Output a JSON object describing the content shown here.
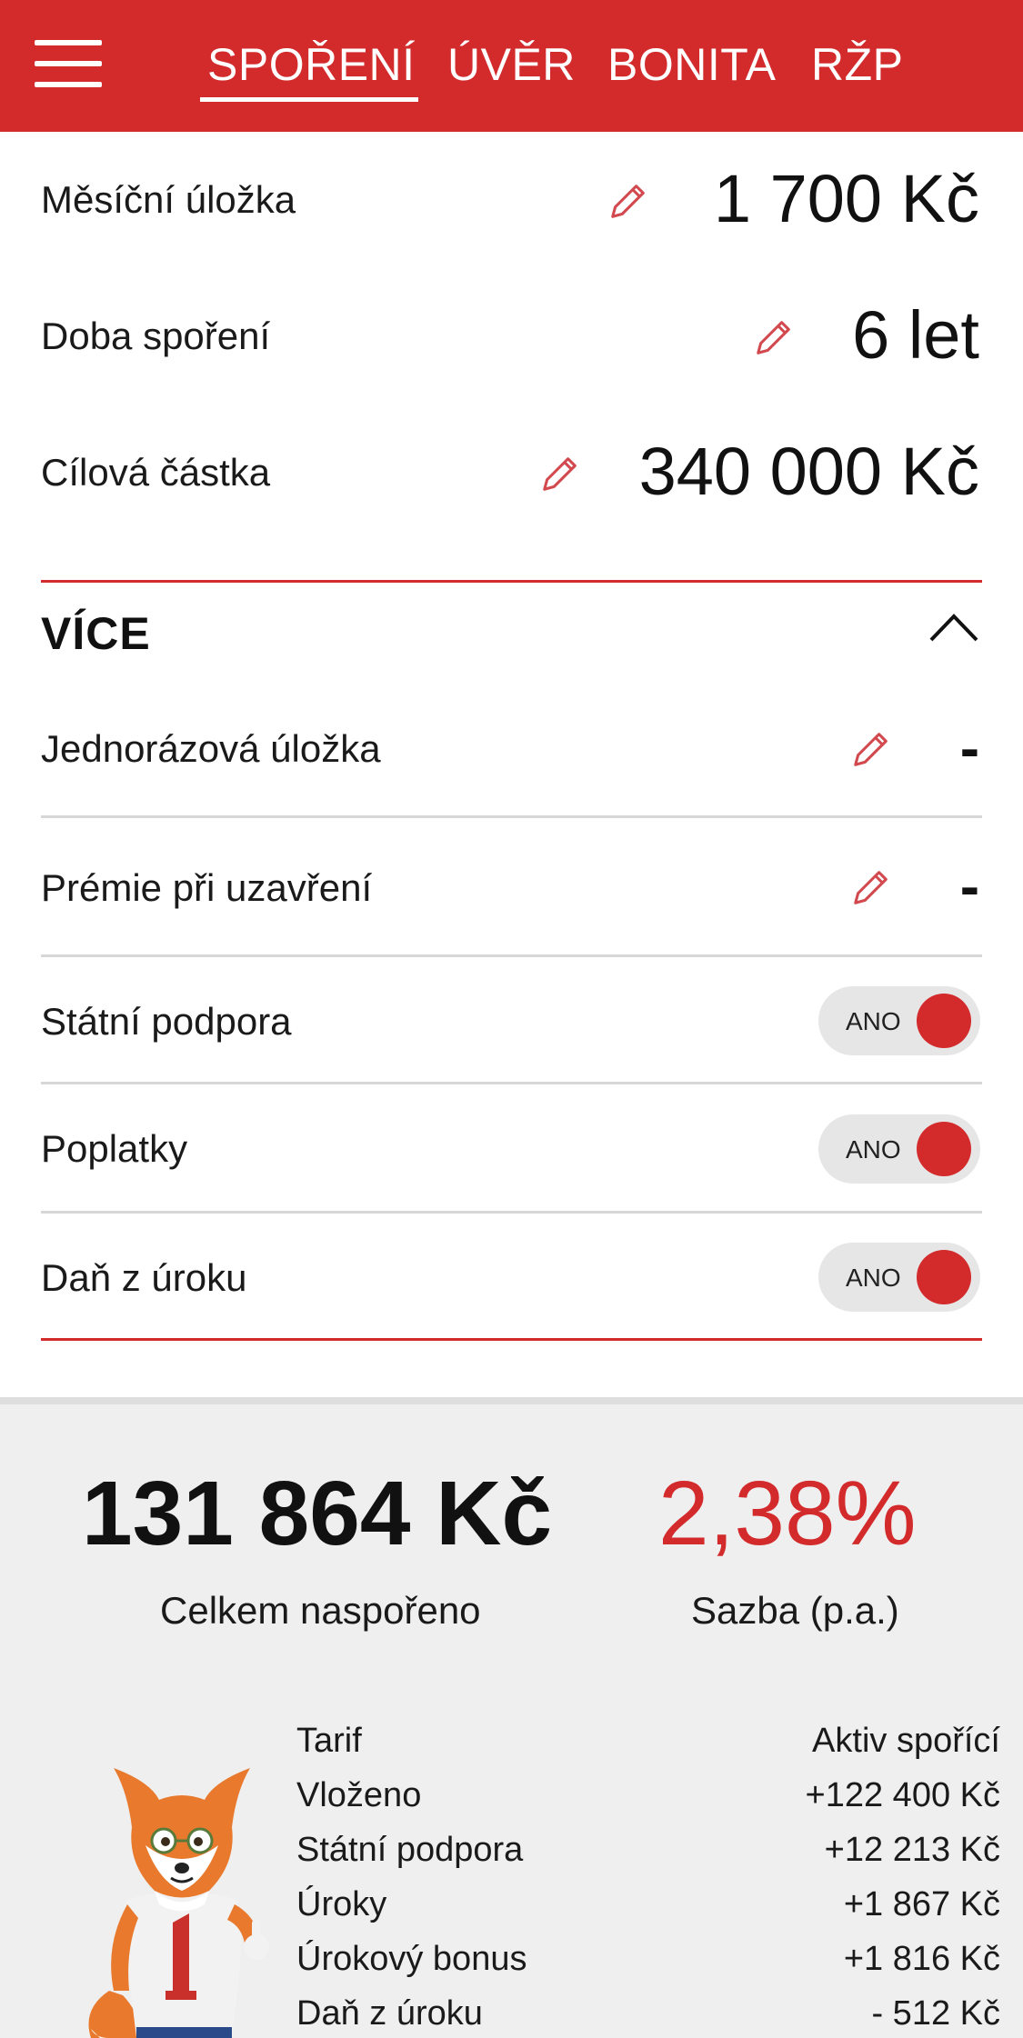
{
  "colors": {
    "brand": "#d32a2c"
  },
  "header": {
    "menu_icon": "hamburger-menu-icon",
    "tabs": [
      {
        "label": "SPOŘENÍ",
        "active": true
      },
      {
        "label": "ÚVĚR",
        "active": false
      },
      {
        "label": "BONITA",
        "active": false
      },
      {
        "label": "RŽP",
        "active": false
      }
    ]
  },
  "inputs": {
    "monthly_deposit": {
      "label": "Měsíční úložka",
      "value": "1 700 Kč",
      "icon": "pencil-icon"
    },
    "saving_period": {
      "label": "Doba spoření",
      "value": "6 let",
      "icon": "pencil-icon"
    },
    "target_amount": {
      "label": "Cílová částka",
      "value": "340 000 Kč",
      "icon": "pencil-icon"
    }
  },
  "more": {
    "title": "VÍCE",
    "icon": "chevron-up-icon",
    "one_time_deposit": {
      "label": "Jednorázová úložka",
      "value": "-"
    },
    "closing_bonus": {
      "label": "Prémie při uzavření",
      "value": "-"
    },
    "state_support": {
      "label": "Státní podpora",
      "toggle": "ANO",
      "on": true
    },
    "fees": {
      "label": "Poplatky",
      "toggle": "ANO",
      "on": true
    },
    "interest_tax": {
      "label": "Daň z úroku",
      "toggle": "ANO",
      "on": true
    }
  },
  "summary": {
    "total_value": "131 864 Kč",
    "total_caption": "Celkem naspořeno",
    "rate_value": "2,38%",
    "rate_caption": "Sazba (p.a.)",
    "mascot": "fox-mascot",
    "details": [
      {
        "label": "Tarif",
        "value": "Aktiv spořící"
      },
      {
        "label": "Vloženo",
        "value": "+122 400 Kč"
      },
      {
        "label": "Státní podpora",
        "value": "+12 213 Kč"
      },
      {
        "label": "Úroky",
        "value": "+1 867 Kč"
      },
      {
        "label": "Úrokový bonus",
        "value": "+1 816 Kč"
      },
      {
        "label": "Daň z úroku",
        "value": "- 512 Kč"
      }
    ]
  }
}
